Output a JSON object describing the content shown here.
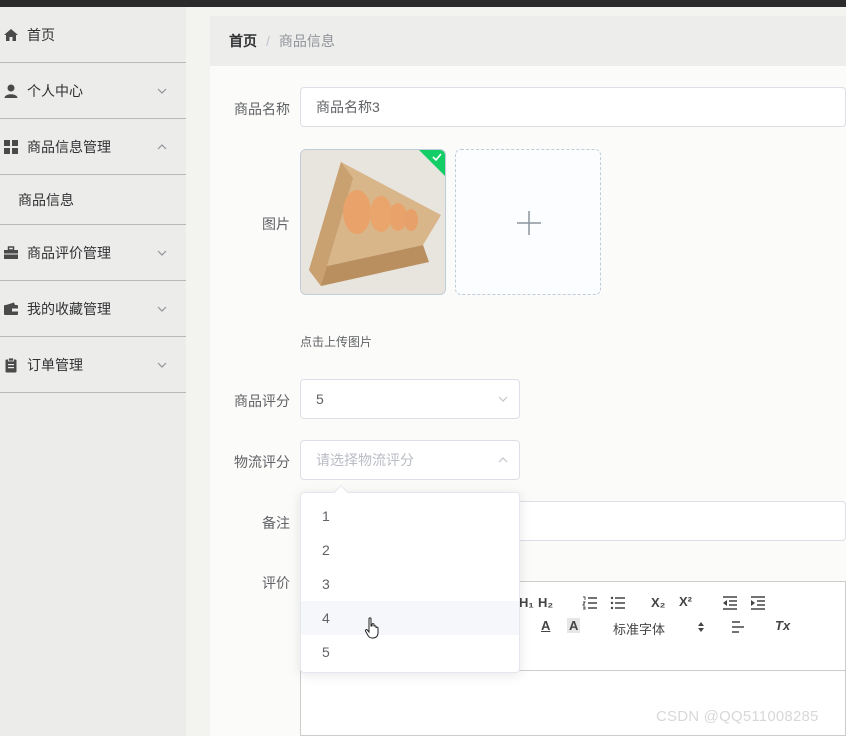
{
  "sidebar": {
    "items": [
      {
        "label": "首页",
        "icon": "home-icon"
      },
      {
        "label": "个人中心",
        "icon": "user-icon"
      },
      {
        "label": "商品信息管理",
        "icon": "grid-icon"
      },
      {
        "label": "商品评价管理",
        "icon": "briefcase-icon"
      },
      {
        "label": "我的收藏管理",
        "icon": "wallet-icon"
      },
      {
        "label": "订单管理",
        "icon": "clipboard-icon"
      }
    ],
    "subitem": "商品信息"
  },
  "breadcrumb": {
    "home": "首页",
    "separator": "/",
    "current": "商品信息"
  },
  "form": {
    "name_label": "商品名称",
    "name_value": "商品名称3",
    "image_label": "图片",
    "upload_tip": "点击上传图片",
    "rating_label": "商品评分",
    "rating_value": "5",
    "logistics_label": "物流评分",
    "logistics_placeholder": "请选择物流评分",
    "remark_label": "备注",
    "review_label": "评价"
  },
  "dropdown": {
    "options": [
      "1",
      "2",
      "3",
      "4",
      "5"
    ],
    "hovered": "4"
  },
  "editor": {
    "font_select": "标准字体",
    "toolbar_row1": [
      "H₁",
      "H₂",
      "ordered-list",
      "bullet-list",
      "X₂",
      "X²",
      "outdent",
      "indent"
    ],
    "toolbar_row2": [
      "A",
      "A",
      "标准字体",
      "align",
      "Tx"
    ]
  },
  "watermark": "CSDN @QQ511008285",
  "colors": {
    "success": "#13ce66",
    "border": "#dcdfe6",
    "hover": "#f5f7fa"
  }
}
